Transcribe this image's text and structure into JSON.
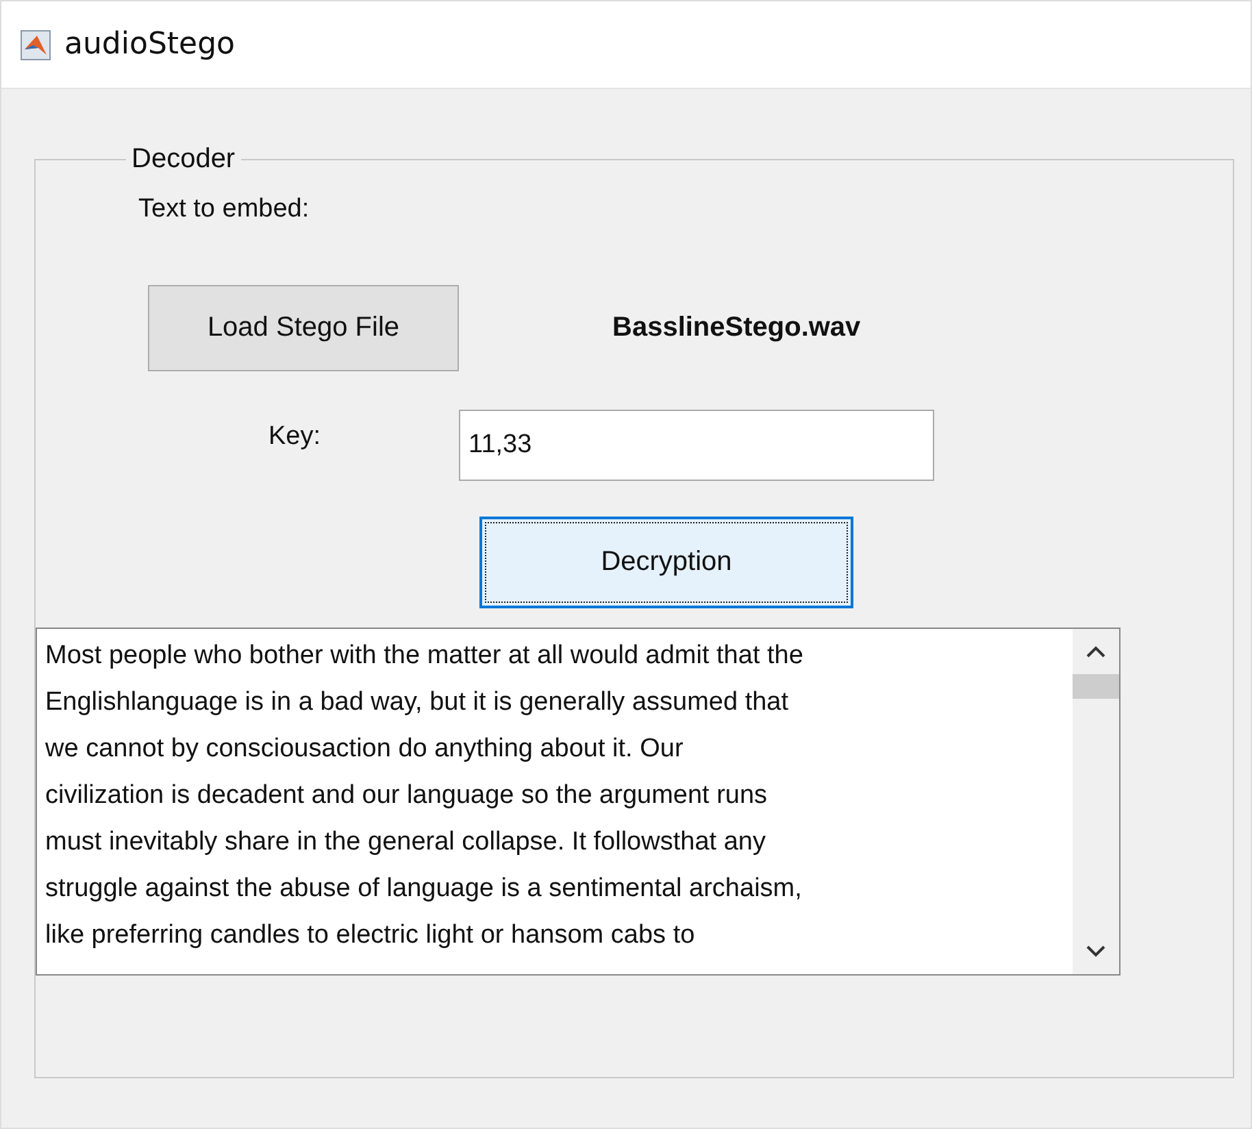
{
  "window": {
    "title": "audioStego"
  },
  "panel": {
    "title": "Decoder",
    "text_label": "Text to embed:",
    "load_button": {
      "label": "Load Stego File",
      "focused": false
    },
    "file_name": "BasslineStego.wav",
    "key": {
      "label": "Key:",
      "value": "11,33"
    },
    "decrypt_button": {
      "label": "Decryption",
      "focused": true
    },
    "output_lines": [
      "Most people who bother with the matter at all would admit that the",
      "Englishlanguage is in a bad way, but it is generally assumed that",
      "we cannot by consciousaction do anything about it. Our",
      "civilization is decadent and our language so the argument runs",
      "must inevitably share in the general collapse. It followsthat any",
      "struggle against the abuse of language is a sentimental archaism,",
      "like preferring candles to electric light or hansom cabs to"
    ]
  }
}
